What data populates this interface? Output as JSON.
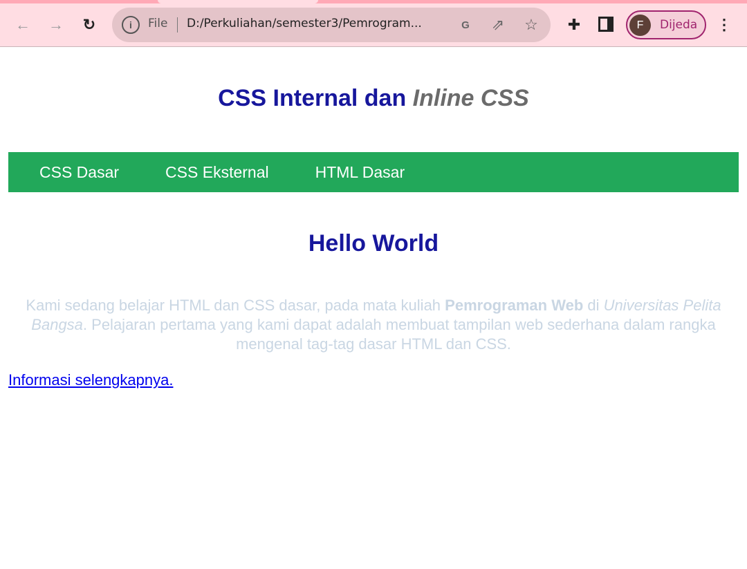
{
  "browser": {
    "file_label": "File",
    "url": "D:/Perkuliahan/semester3/Pemrogram...",
    "profile_initial": "F",
    "profile_name": "Dijeda",
    "icons": [
      "back-icon",
      "forward-icon",
      "reload-icon",
      "info-icon",
      "translate-icon",
      "share-icon",
      "star-icon",
      "extensions-icon",
      "side-panel-icon",
      "menu-icon"
    ]
  },
  "page": {
    "title_plain": "CSS Internal dan ",
    "title_italic": "Inline CSS",
    "nav": [
      "CSS Dasar",
      "CSS Eksternal",
      "HTML Dasar"
    ],
    "heading": "Hello World",
    "para": {
      "t1": "Kami sedang belajar HTML dan CSS dasar, pada mata kuliah ",
      "bold": "Pemrograman Web",
      "t2": " di ",
      "italic": "Universitas Pelita Bangsa",
      "t3": ". Pelajaran pertama yang kami dapat adalah membuat tampilan web sederhana dalam rangka mengenal tag-tag dasar HTML dan CSS."
    },
    "link": "Informasi selengkapnya."
  },
  "colors": {
    "nav_bg": "#22a85a",
    "heading": "#17179c",
    "italic": "#6b6b6b",
    "para": "#c9d6e3",
    "link": "#0000ee"
  }
}
